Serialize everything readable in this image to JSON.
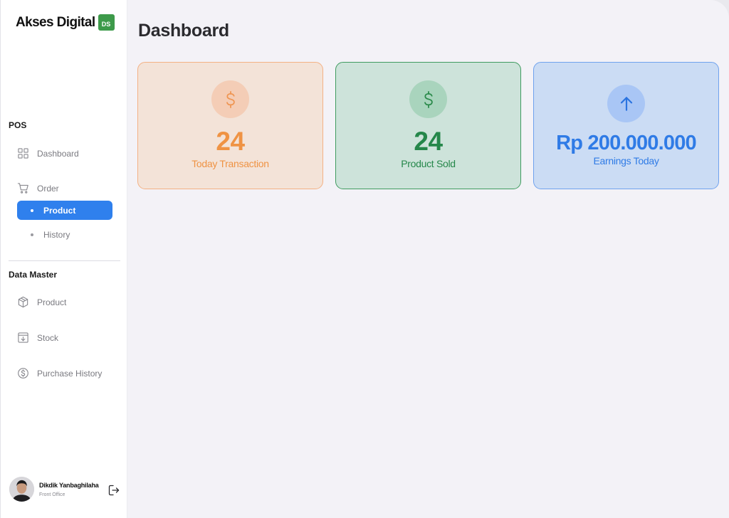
{
  "brand": {
    "name": "Akses Digital",
    "badge": "DS"
  },
  "sidebar": {
    "pos_title": "POS",
    "dashboard_label": "Dashboard",
    "order_label": "Order",
    "order_sub": [
      {
        "label": "Product",
        "active": true
      },
      {
        "label": "History",
        "active": false
      }
    ],
    "master_title": "Data Master",
    "master_items": [
      {
        "label": "Product",
        "icon": "box-icon"
      },
      {
        "label": "Stock",
        "icon": "inbox-download-icon"
      },
      {
        "label": "Purchase History",
        "icon": "dollar-circle-icon"
      }
    ],
    "user": {
      "name": "Dikdik Yanbaghilaha",
      "role": "Front Office"
    }
  },
  "main": {
    "title": "Dashboard",
    "cards": [
      {
        "value": "24",
        "label": "Today Transaction",
        "icon": "dollar-icon",
        "color": "#ef9344"
      },
      {
        "value": "24",
        "label": "Product Sold",
        "icon": "dollar-icon",
        "color": "#25874a"
      },
      {
        "value": "Rp 200.000.000",
        "label": "Earnings Today",
        "icon": "arrow-up-icon",
        "color": "#2f7be6"
      }
    ]
  }
}
